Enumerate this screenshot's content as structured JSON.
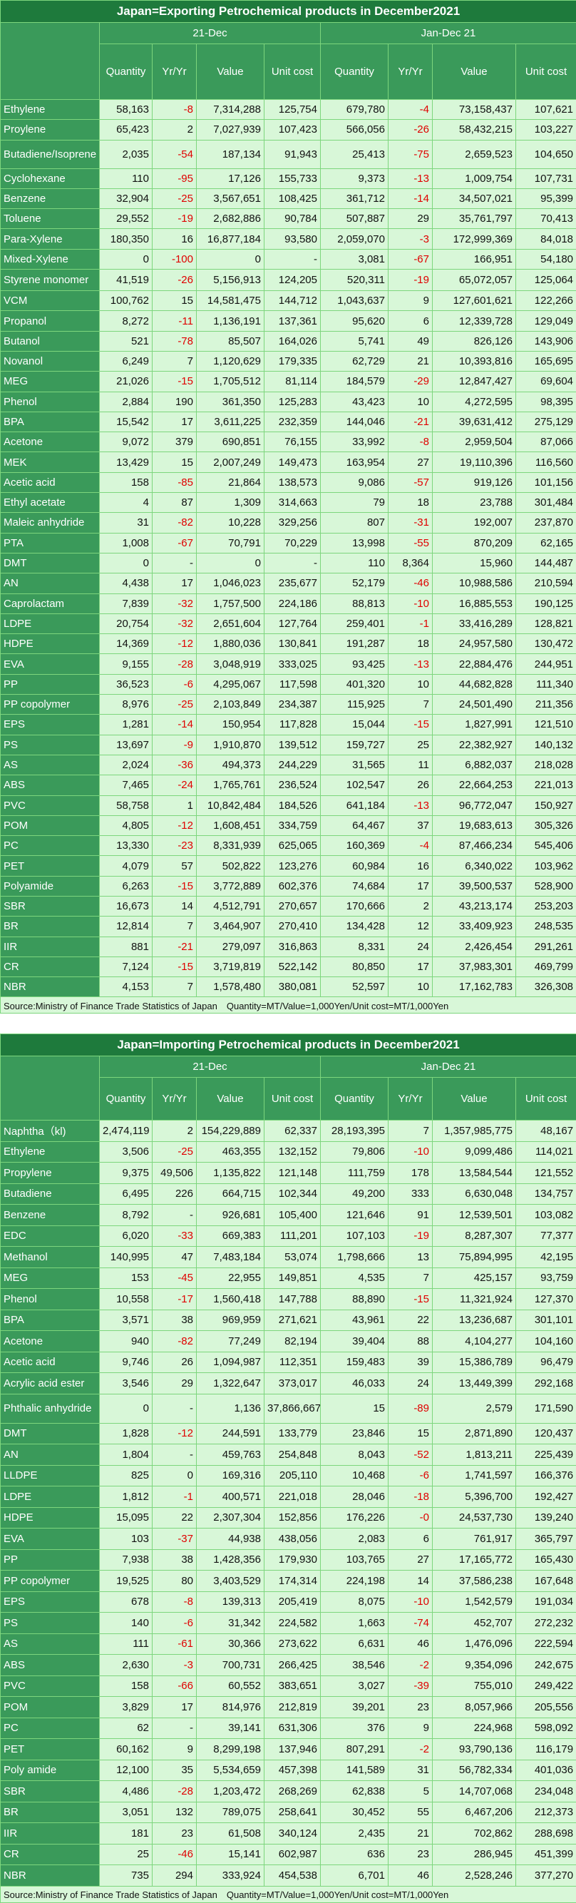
{
  "export": {
    "title": "Japan=Exporting Petrochemical products in December2021",
    "period1": "21-Dec",
    "period2": "Jan-Dec 21",
    "columns": [
      "Quantity",
      "Yr/Yr",
      "Value",
      "Unit cost",
      "Quantity",
      "Yr/Yr",
      "Value",
      "Unit cost"
    ],
    "source": "Source:Ministry of Finance Trade Statistics of Japan　Quantity=MT/Value=1,000Yen/Unit cost=MT/1,000Yen",
    "rows": [
      [
        "Ethylene",
        "58,163",
        "-8",
        "7,314,288",
        "125,754",
        "679,780",
        "-4",
        "73,158,437",
        "107,621"
      ],
      [
        "Proylene",
        "65,423",
        "2",
        "7,027,939",
        "107,423",
        "566,056",
        "-26",
        "58,432,215",
        "103,227"
      ],
      [
        "Butadiene/Isoprene",
        "2,035",
        "-54",
        "187,134",
        "91,943",
        "25,413",
        "-75",
        "2,659,523",
        "104,650"
      ],
      [
        "Cyclohexane",
        "110",
        "-95",
        "17,126",
        "155,733",
        "9,373",
        "-13",
        "1,009,754",
        "107,731"
      ],
      [
        "Benzene",
        "32,904",
        "-25",
        "3,567,651",
        "108,425",
        "361,712",
        "-14",
        "34,507,021",
        "95,399"
      ],
      [
        "Toluene",
        "29,552",
        "-19",
        "2,682,886",
        "90,784",
        "507,887",
        "29",
        "35,761,797",
        "70,413"
      ],
      [
        "Para-Xylene",
        "180,350",
        "16",
        "16,877,184",
        "93,580",
        "2,059,070",
        "-3",
        "172,999,369",
        "84,018"
      ],
      [
        "Mixed-Xylene",
        "0",
        "-100",
        "0",
        "-",
        "3,081",
        "-67",
        "166,951",
        "54,180"
      ],
      [
        "Styrene monomer",
        "41,519",
        "-26",
        "5,156,913",
        "124,205",
        "520,311",
        "-19",
        "65,072,057",
        "125,064"
      ],
      [
        "VCM",
        "100,762",
        "15",
        "14,581,475",
        "144,712",
        "1,043,637",
        "9",
        "127,601,621",
        "122,266"
      ],
      [
        "Propanol",
        "8,272",
        "-11",
        "1,136,191",
        "137,361",
        "95,620",
        "6",
        "12,339,728",
        "129,049"
      ],
      [
        "Butanol",
        "521",
        "-78",
        "85,507",
        "164,026",
        "5,741",
        "49",
        "826,126",
        "143,906"
      ],
      [
        "Novanol",
        "6,249",
        "7",
        "1,120,629",
        "179,335",
        "62,729",
        "21",
        "10,393,816",
        "165,695"
      ],
      [
        "MEG",
        "21,026",
        "-15",
        "1,705,512",
        "81,114",
        "184,579",
        "-29",
        "12,847,427",
        "69,604"
      ],
      [
        "Phenol",
        "2,884",
        "190",
        "361,350",
        "125,283",
        "43,423",
        "10",
        "4,272,595",
        "98,395"
      ],
      [
        "BPA",
        "15,542",
        "17",
        "3,611,225",
        "232,359",
        "144,046",
        "-21",
        "39,631,412",
        "275,129"
      ],
      [
        "Acetone",
        "9,072",
        "379",
        "690,851",
        "76,155",
        "33,992",
        "-8",
        "2,959,504",
        "87,066"
      ],
      [
        "MEK",
        "13,429",
        "15",
        "2,007,249",
        "149,473",
        "163,954",
        "27",
        "19,110,396",
        "116,560"
      ],
      [
        "Acetic acid",
        "158",
        "-85",
        "21,864",
        "138,573",
        "9,086",
        "-57",
        "919,126",
        "101,156"
      ],
      [
        "Ethyl acetate",
        "4",
        "87",
        "1,309",
        "314,663",
        "79",
        "18",
        "23,788",
        "301,484"
      ],
      [
        "Maleic anhydride",
        "31",
        "-82",
        "10,228",
        "329,256",
        "807",
        "-31",
        "192,007",
        "237,870"
      ],
      [
        "PTA",
        "1,008",
        "-67",
        "70,791",
        "70,229",
        "13,998",
        "-55",
        "870,209",
        "62,165"
      ],
      [
        "DMT",
        "0",
        "-",
        "0",
        "-",
        "110",
        "8,364",
        "15,960",
        "144,487"
      ],
      [
        "AN",
        "4,438",
        "17",
        "1,046,023",
        "235,677",
        "52,179",
        "-46",
        "10,988,586",
        "210,594"
      ],
      [
        "Caprolactam",
        "7,839",
        "-32",
        "1,757,500",
        "224,186",
        "88,813",
        "-10",
        "16,885,553",
        "190,125"
      ],
      [
        "LDPE",
        "20,754",
        "-32",
        "2,651,604",
        "127,764",
        "259,401",
        "-1",
        "33,416,289",
        "128,821"
      ],
      [
        "HDPE",
        "14,369",
        "-12",
        "1,880,036",
        "130,841",
        "191,287",
        "18",
        "24,957,580",
        "130,472"
      ],
      [
        "EVA",
        "9,155",
        "-28",
        "3,048,919",
        "333,025",
        "93,425",
        "-13",
        "22,884,476",
        "244,951"
      ],
      [
        "PP",
        "36,523",
        "-6",
        "4,295,067",
        "117,598",
        "401,320",
        "10",
        "44,682,828",
        "111,340"
      ],
      [
        "PP copolymer",
        "8,976",
        "-25",
        "2,103,849",
        "234,387",
        "115,925",
        "7",
        "24,501,490",
        "211,356"
      ],
      [
        "EPS",
        "1,281",
        "-14",
        "150,954",
        "117,828",
        "15,044",
        "-15",
        "1,827,991",
        "121,510"
      ],
      [
        "PS",
        "13,697",
        "-9",
        "1,910,870",
        "139,512",
        "159,727",
        "25",
        "22,382,927",
        "140,132"
      ],
      [
        "AS",
        "2,024",
        "-36",
        "494,373",
        "244,229",
        "31,565",
        "11",
        "6,882,037",
        "218,028"
      ],
      [
        "ABS",
        "7,465",
        "-24",
        "1,765,761",
        "236,524",
        "102,547",
        "26",
        "22,664,253",
        "221,013"
      ],
      [
        "PVC",
        "58,758",
        "1",
        "10,842,484",
        "184,526",
        "641,184",
        "-13",
        "96,772,047",
        "150,927"
      ],
      [
        "POM",
        "4,805",
        "-12",
        "1,608,451",
        "334,759",
        "64,467",
        "37",
        "19,683,613",
        "305,326"
      ],
      [
        "PC",
        "13,330",
        "-23",
        "8,331,939",
        "625,065",
        "160,369",
        "-4",
        "87,466,234",
        "545,406"
      ],
      [
        "PET",
        "4,079",
        "57",
        "502,822",
        "123,276",
        "60,984",
        "16",
        "6,340,022",
        "103,962"
      ],
      [
        "Polyamide",
        "6,263",
        "-15",
        "3,772,889",
        "602,376",
        "74,684",
        "17",
        "39,500,537",
        "528,900"
      ],
      [
        "SBR",
        "16,673",
        "14",
        "4,512,791",
        "270,657",
        "170,666",
        "2",
        "43,213,174",
        "253,203"
      ],
      [
        "BR",
        "12,814",
        "7",
        "3,464,907",
        "270,410",
        "134,428",
        "12",
        "33,409,923",
        "248,535"
      ],
      [
        "IIR",
        "881",
        "-21",
        "279,097",
        "316,863",
        "8,331",
        "24",
        "2,426,454",
        "291,261"
      ],
      [
        "CR",
        "7,124",
        "-15",
        "3,719,819",
        "522,142",
        "80,850",
        "17",
        "37,983,301",
        "469,799"
      ],
      [
        "NBR",
        "4,153",
        "7",
        "1,578,480",
        "380,081",
        "52,597",
        "10",
        "17,162,783",
        "326,308"
      ]
    ]
  },
  "import": {
    "title": "Japan=Importing Petrochemical products in December2021",
    "period1": "21-Dec",
    "period2": "Jan-Dec 21",
    "columns": [
      "Quantity",
      "Yr/Yr",
      "Value",
      "Unit cost",
      "Quantity",
      "Yr/Yr",
      "Value",
      "Unit cost"
    ],
    "source": "Source:Ministry of Finance Trade Statistics of Japan　Quantity=MT/Value=1,000Yen/Unit cost=MT/1,000Yen",
    "rows": [
      [
        "Naphtha（kl)",
        "2,474,119",
        "2",
        "154,229,889",
        "62,337",
        "28,193,395",
        "7",
        "1,357,985,775",
        "48,167"
      ],
      [
        "Ethylene",
        "3,506",
        "-25",
        "463,355",
        "132,152",
        "79,806",
        "-10",
        "9,099,486",
        "114,021"
      ],
      [
        "Propylene",
        "9,375",
        "49,506",
        "1,135,822",
        "121,148",
        "111,759",
        "178",
        "13,584,544",
        "121,552"
      ],
      [
        "Butadiene",
        "6,495",
        "226",
        "664,715",
        "102,344",
        "49,200",
        "333",
        "6,630,048",
        "134,757"
      ],
      [
        "Benzene",
        "8,792",
        "-",
        "926,681",
        "105,400",
        "121,646",
        "91",
        "12,539,501",
        "103,082"
      ],
      [
        "EDC",
        "6,020",
        "-33",
        "669,383",
        "111,201",
        "107,103",
        "-19",
        "8,287,307",
        "77,377"
      ],
      [
        "Methanol",
        "140,995",
        "47",
        "7,483,184",
        "53,074",
        "1,798,666",
        "13",
        "75,894,995",
        "42,195"
      ],
      [
        "MEG",
        "153",
        "-45",
        "22,955",
        "149,851",
        "4,535",
        "7",
        "425,157",
        "93,759"
      ],
      [
        "Phenol",
        "10,558",
        "-17",
        "1,560,418",
        "147,788",
        "88,890",
        "-15",
        "11,321,924",
        "127,370"
      ],
      [
        "BPA",
        "3,571",
        "38",
        "969,959",
        "271,621",
        "43,961",
        "22",
        "13,236,687",
        "301,101"
      ],
      [
        "Acetone",
        "940",
        "-82",
        "77,249",
        "82,194",
        "39,404",
        "88",
        "4,104,277",
        "104,160"
      ],
      [
        "Acetic acid",
        "9,746",
        "26",
        "1,094,987",
        "112,351",
        "159,483",
        "39",
        "15,386,789",
        "96,479"
      ],
      [
        "Acrylic acid ester",
        "3,546",
        "29",
        "1,322,647",
        "373,017",
        "46,033",
        "24",
        "13,449,399",
        "292,168"
      ],
      [
        "Phthalic anhydride",
        "0",
        "-",
        "1,136",
        "37,866,667",
        "15",
        "-89",
        "2,579",
        "171,590"
      ],
      [
        "DMT",
        "1,828",
        "-12",
        "244,591",
        "133,779",
        "23,846",
        "15",
        "2,871,890",
        "120,437"
      ],
      [
        "AN",
        "1,804",
        "-",
        "459,763",
        "254,848",
        "8,043",
        "-52",
        "1,813,211",
        "225,439"
      ],
      [
        "LLDPE",
        "825",
        "0",
        "169,316",
        "205,110",
        "10,468",
        "-6",
        "1,741,597",
        "166,376"
      ],
      [
        "LDPE",
        "1,812",
        "-1",
        "400,571",
        "221,018",
        "28,046",
        "-18",
        "5,396,700",
        "192,427"
      ],
      [
        "HDPE",
        "15,095",
        "22",
        "2,307,304",
        "152,856",
        "176,226",
        "-0",
        "24,537,730",
        "139,240"
      ],
      [
        "EVA",
        "103",
        "-37",
        "44,938",
        "438,056",
        "2,083",
        "6",
        "761,917",
        "365,797"
      ],
      [
        "PP",
        "7,938",
        "38",
        "1,428,356",
        "179,930",
        "103,765",
        "27",
        "17,165,772",
        "165,430"
      ],
      [
        "PP copolymer",
        "19,525",
        "80",
        "3,403,529",
        "174,314",
        "224,198",
        "14",
        "37,586,238",
        "167,648"
      ],
      [
        "EPS",
        "678",
        "-8",
        "139,313",
        "205,419",
        "8,075",
        "-10",
        "1,542,579",
        "191,034"
      ],
      [
        "PS",
        "140",
        "-6",
        "31,342",
        "224,582",
        "1,663",
        "-74",
        "452,707",
        "272,232"
      ],
      [
        "AS",
        "111",
        "-61",
        "30,366",
        "273,622",
        "6,631",
        "46",
        "1,476,096",
        "222,594"
      ],
      [
        "ABS",
        "2,630",
        "-3",
        "700,731",
        "266,425",
        "38,546",
        "-2",
        "9,354,096",
        "242,675"
      ],
      [
        "PVC",
        "158",
        "-66",
        "60,552",
        "383,651",
        "3,027",
        "-39",
        "755,010",
        "249,422"
      ],
      [
        "POM",
        "3,829",
        "17",
        "814,976",
        "212,819",
        "39,201",
        "23",
        "8,057,966",
        "205,556"
      ],
      [
        "PC",
        "62",
        "-",
        "39,141",
        "631,306",
        "376",
        "9",
        "224,968",
        "598,092"
      ],
      [
        "PET",
        "60,162",
        "9",
        "8,299,198",
        "137,946",
        "807,291",
        "-2",
        "93,790,136",
        "116,179"
      ],
      [
        "Poly amide",
        "12,100",
        "35",
        "5,534,659",
        "457,398",
        "141,589",
        "31",
        "56,782,334",
        "401,036"
      ],
      [
        "SBR",
        "4,486",
        "-28",
        "1,203,472",
        "268,269",
        "62,838",
        "5",
        "14,707,068",
        "234,048"
      ],
      [
        "BR",
        "3,051",
        "132",
        "789,075",
        "258,641",
        "30,452",
        "55",
        "6,467,206",
        "212,373"
      ],
      [
        "IIR",
        "181",
        "23",
        "61,508",
        "340,124",
        "2,435",
        "21",
        "702,862",
        "288,698"
      ],
      [
        "CR",
        "25",
        "-46",
        "15,141",
        "602,987",
        "636",
        "23",
        "286,945",
        "451,399"
      ],
      [
        "NBR",
        "735",
        "294",
        "333,924",
        "454,538",
        "6,701",
        "46",
        "2,528,246",
        "377,270"
      ]
    ]
  }
}
